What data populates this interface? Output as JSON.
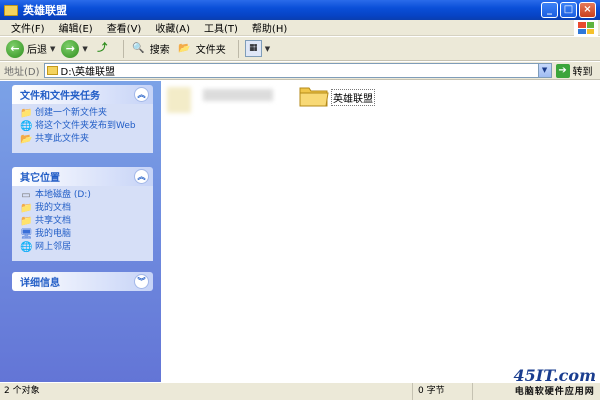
{
  "window": {
    "title": "英雄联盟"
  },
  "menu": {
    "items": [
      "文件(F)",
      "编辑(E)",
      "查看(V)",
      "收藏(A)",
      "工具(T)",
      "帮助(H)"
    ]
  },
  "toolbar": {
    "back_label": "后退",
    "search_label": "搜索",
    "folders_label": "文件夹"
  },
  "address": {
    "label": "地址(D)",
    "value": "D:\\英雄联盟",
    "go_label": "转到"
  },
  "tasks": {
    "file_tasks": {
      "header": "文件和文件夹任务",
      "items": [
        {
          "label": "创建一个新文件夹",
          "icon": "new-folder-icon"
        },
        {
          "label": "将这个文件夹发布到Web",
          "icon": "publish-web-icon"
        },
        {
          "label": "共享此文件夹",
          "icon": "share-folder-icon"
        }
      ]
    },
    "other_places": {
      "header": "其它位置",
      "items": [
        {
          "label": "本地磁盘 (D:)",
          "icon": "local-disk-icon"
        },
        {
          "label": "我的文档",
          "icon": "my-documents-icon"
        },
        {
          "label": "共享文档",
          "icon": "shared-documents-icon"
        },
        {
          "label": "我的电脑",
          "icon": "my-computer-icon"
        },
        {
          "label": "网上邻居",
          "icon": "network-places-icon"
        }
      ]
    },
    "details": {
      "header": "详细信息"
    }
  },
  "main": {
    "folder_name": "英雄联盟"
  },
  "status": {
    "objects": "2 个对象",
    "bytes": "0 字节"
  },
  "watermark": {
    "logo": "45IT.com",
    "sub": "电脑软硬件应用网"
  },
  "colors": {
    "title_blue": "#0a4fd8",
    "task_pane": "#6f8ce0",
    "link_blue": "#215dc6"
  }
}
